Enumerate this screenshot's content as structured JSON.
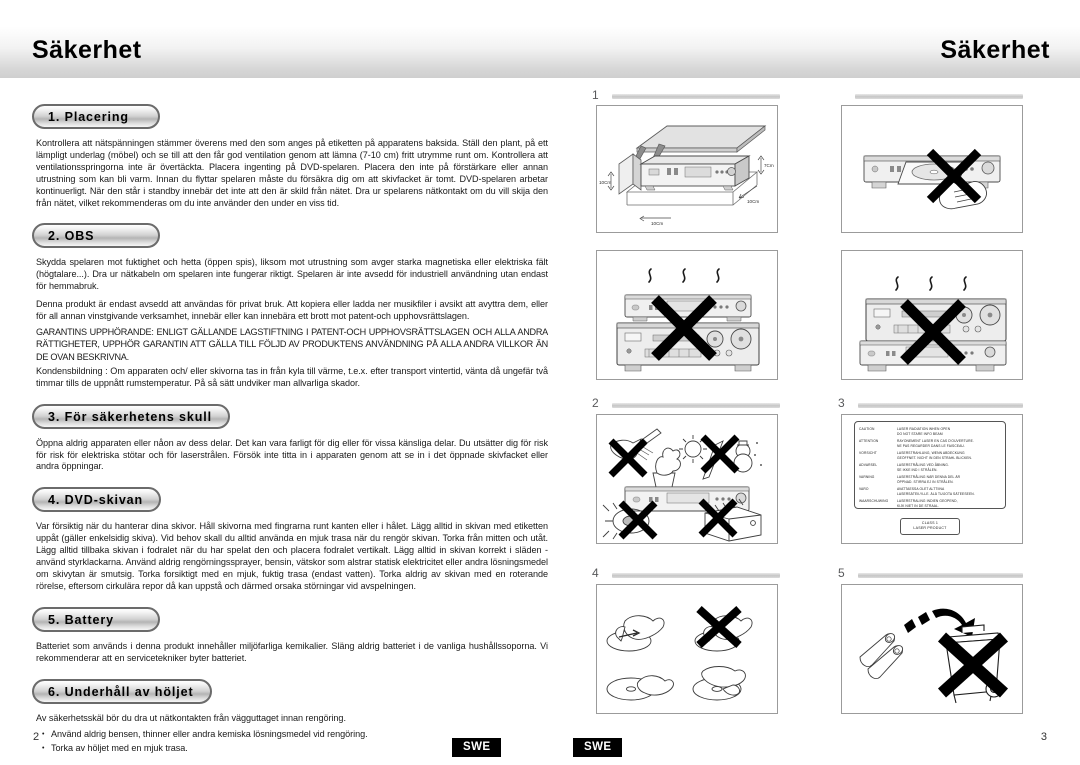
{
  "document": {
    "left_page": {
      "title": "Säkerhet",
      "folio": "2",
      "language_tag": "SWE"
    },
    "right_page": {
      "title": "Säkerhet",
      "folio": "3",
      "language_tag": "SWE"
    }
  },
  "sections": [
    {
      "heading": "1. Placering",
      "paragraphs": [
        "Kontrollera att nätspänningen stämmer överens med den som anges på etiketten på apparatens baksida. Ställ den plant, på ett lämpligt underlag (möbel) och se till att den får god ventilation genom att lämna (7-10 cm) fritt utrymme runt om. Kontrollera att ventilationsspringorna inte är övertäckta. Placera ingenting på DVD-spelaren. Placera den inte på förstärkare eller annan utrustning som kan bli varm. Innan du flyttar spelaren måste du försäkra dig om att skivfacket är tomt. DVD-spelaren arbetar kontinuerligt. När den står i standby innebär det inte att den är skild från nätet. Dra ur spelarens nätkontakt om du vill skija den från nätet, vilket rekommenderas om du inte använder den under en viss tid."
      ]
    },
    {
      "heading": "2. OBS",
      "paragraphs": [
        "Skydda spelaren mot fuktighet och hetta (öppen spis), liksom mot utrustning som avger starka magnetiska eller elektriska fält (högtalare...). Dra ur nätkabeln om spelaren inte fungerar riktigt. Spelaren är inte avsedd för industriell användning utan endast för hemmabruk.",
        "Denna produkt är endast avsedd att användas för privat bruk. Att kopiera eller ladda ner musikfiler i avsikt att avyttra dem, eller för all annan vinstgivande verksamhet, innebär eller kan innebära ett brott mot patent-och upphovsrättslagen.",
        "GARANTINS UPPHÖRANDE: ENLIGT GÄLLANDE LAGSTIFTNING I PATENT-OCH UPPHOVSRÄTTSLAGEN OCH ALLA ANDRA RÄTTIGHETER, UPPHÖR GARANTIN ATT GÄLLA TILL FÖLJD AV PRODUKTENS ANVÄNDNING PÅ ALLA ANDRA VILLKOR ÄN DE OVAN BESKRIVNA.",
        "Kondensbildning : Om apparaten och/ eller skivorna tas in från kyla till värme, t.e.x. efter transport vintertid, vänta då ungefär två timmar tills de uppnått rumstemperatur. På så sätt undviker man allvarliga skador."
      ]
    },
    {
      "heading": "3. För säkerhetens skull",
      "paragraphs": [
        "Öppna aldrig apparaten eller nåon av dess delar. Det kan vara farligt för dig eller för vissa känsliga delar. Du utsätter dig för risk för risk för elektriska stötar och för laserstrålen. Försök inte titta in i apparaten genom att se in i det öppnade skivfacket eller andra öppningar."
      ]
    },
    {
      "heading": "4. DVD-skivan",
      "paragraphs": [
        "Var försiktig när du hanterar dina skivor. Håll skivorna med fingrarna runt kanten eller i hålet. Lägg alltid in skivan med etiketten uppåt (gäller enkelsidig skiva). Vid behov skall du alltid använda en mjuk trasa när du rengör skivan. Torka från mitten och utåt. Lägg alltid tillbaka skivan i fodralet när du har spelat den och placera fodralet vertikalt. Lägg alltid in skivan korrekt i släden - använd styrklackarna. Använd aldrig rengörningssprayer, bensin, vätskor som alstrar statisk elektricitet eller andra lösningsmedel om skivytan är smutsig. Torka forsiktigt med en mjuk, fuktig trasa (endast vatten). Torka aldrig av skivan med en roterande rörelse, eftersom cirkulära repor då kan uppstå och därmed orsaka störningar vid avspelningen."
      ]
    },
    {
      "heading": "5. Battery",
      "paragraphs": [
        "Batteriet som används i denna produkt innehåller miljöfarliga kemikalier. Släng aldrig batteriet i de vanliga hushållssoporna. Vi rekommenderar att en servicetekniker byter batteriet."
      ]
    },
    {
      "heading": "6. Underhåll av höljet",
      "paragraphs": [
        "Av säkerhetsskäl bör du dra ut nätkontakten från vägguttaget innan rengöring."
      ],
      "bullets": [
        "Använd aldrig bensen, thinner eller andra kemiska lösningsmedel vid rengöring.",
        "Torka av höljet med en mjuk trasa."
      ]
    }
  ],
  "figures": [
    {
      "number": "1",
      "name": "placement-clearance",
      "dimension_labels": [
        "7Cm",
        "10Cm",
        "10Cm",
        "10Cm"
      ]
    },
    {
      "number": "",
      "name": "no-hand-on-open-tray"
    },
    {
      "number": "",
      "name": "no-stack-on-amplifier-heat"
    },
    {
      "number": "",
      "name": "no-amplifier-on-player-heat"
    },
    {
      "number": "2",
      "name": "avoid-heat-moisture-sunlight"
    },
    {
      "number": "3",
      "name": "laser-warning-label",
      "label": {
        "rows": [
          {
            "lang": "CAUTION",
            "text": "LASER RADIATION WHEN OPEN\nDO NOT STARE INFO BEAM"
          },
          {
            "lang": "ATTENTION",
            "text": "RAYONEMENT LASER EN CAS D'OUVERTURE.\nNE PAS REGARDER DANS LE FAISCEAU."
          },
          {
            "lang": "VORSICHT",
            "text": "LASERSTRAHLUNG, WENN ABDECKUNG\nGEÖFFNET. NICHT IN DEN STRAHL BLICKEN."
          },
          {
            "lang": "ADVARSEL",
            "text": "LASERSTRÅLING VED ÅBNING.\nSE IKKE IND I STRÅLEN."
          },
          {
            "lang": "VARNING",
            "text": "LASERSTRÅLING NÄR DENNA DEL ÄR\nÖPPNAD. STIRRA EJ IN STRÅLEN."
          },
          {
            "lang": "VARO",
            "text": "AVATTAESSA OLET ALTTIINA\nLASERSÄTEILYLLE. ÄLÄ TUIJOTA SÄTEESEEN."
          },
          {
            "lang": "WAARSCHUWING",
            "text": "LASERSTRALING INDIEN GEOPEND,\nKIJK NIET IN DE STRAAL."
          }
        ],
        "class_badge": "CLASS 1\nLASER PRODUCT"
      }
    },
    {
      "number": "4",
      "name": "disc-handling"
    },
    {
      "number": "5",
      "name": "battery-disposal"
    }
  ],
  "colors": {
    "ink": "#000000",
    "body_text": "#1a1a1a",
    "fig_number": "#58595b",
    "rule": "#c6c6c6",
    "tag_bg": "#000000",
    "tag_fg": "#ffffff"
  }
}
